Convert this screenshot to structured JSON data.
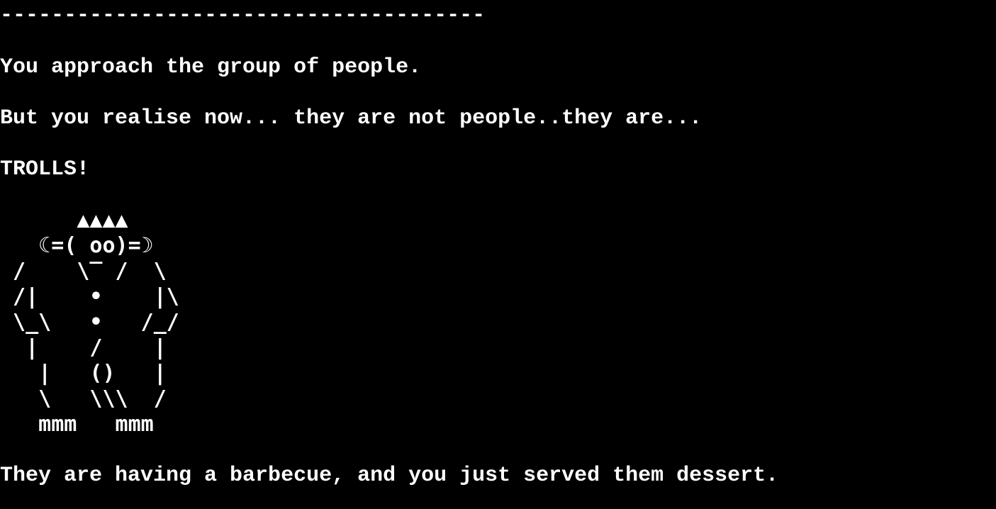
{
  "terminal": {
    "separator": "--------------------------------------",
    "story": {
      "line1": "You approach the group of people.",
      "line2": "But you realise now... they are not people..they are...",
      "line3": "TROLLS!",
      "line4": "They are having a barbecue, and you just served them dessert."
    },
    "troll_art": [
      "      ▲▲▲▲",
      "   ☾=( oo)=☽",
      " /    \\‾ /  \\",
      " /|    •    |\\",
      " \\_\\   •   /_/",
      "  |    /    |",
      "   |   ()   |",
      "   \\   \\\\\\  /",
      "   mmm   mmm"
    ]
  }
}
